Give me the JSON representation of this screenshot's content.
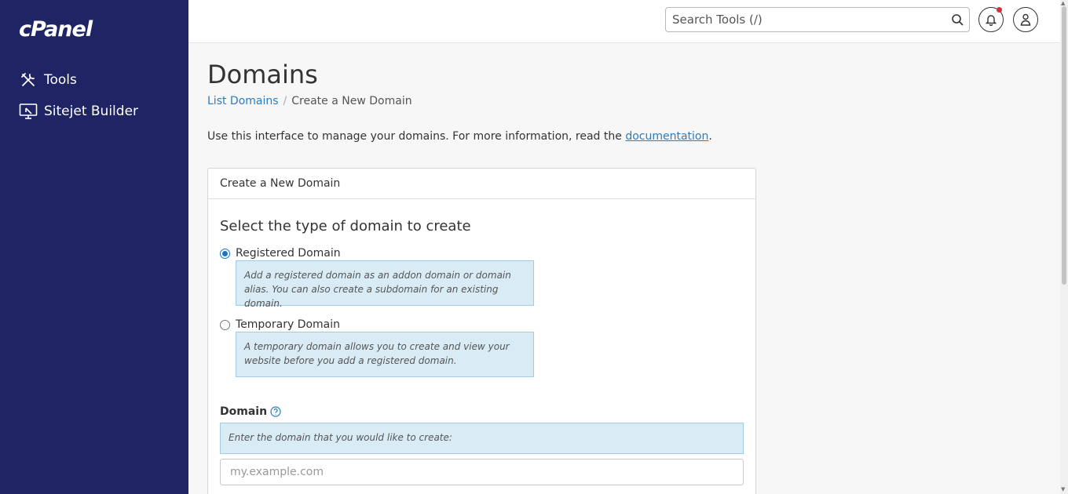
{
  "sidebar": {
    "logo": "cPanel",
    "items": [
      {
        "label": "Tools",
        "icon": "tools-icon"
      },
      {
        "label": "Sitejet Builder",
        "icon": "sitejet-icon"
      }
    ]
  },
  "header": {
    "search_placeholder": "Search Tools (/)",
    "icons": [
      "search-icon",
      "bell-icon",
      "user-icon"
    ]
  },
  "page": {
    "title": "Domains",
    "breadcrumb": [
      {
        "label": "List Domains"
      },
      {
        "label": "Create a New Domain"
      }
    ],
    "intro_text": "Use this interface to manage your domains. For more information, read the",
    "intro_link": "documentation",
    "intro_end": "."
  },
  "panel": {
    "header": "Create a New Domain",
    "section_title": "Select the type of domain to create",
    "options": [
      {
        "label": "Registered Domain",
        "checked": true,
        "help": "Add a registered domain as an addon domain or domain alias. You can also create a subdomain for an existing domain."
      },
      {
        "label": "Temporary Domain",
        "checked": false,
        "help": "A temporary domain allows you to create and view your website before you add a registered domain."
      }
    ],
    "domain_label": "Domain",
    "domain_hint": "Enter the domain that you would like to create:",
    "domain_placeholder": "my.example.com",
    "domain_value": ""
  },
  "colors": {
    "sidebar_bg": "#1f2464",
    "link": "#2e7bbd",
    "help_bg": "#d9ebf5",
    "notification_dot": "#d0323a"
  }
}
